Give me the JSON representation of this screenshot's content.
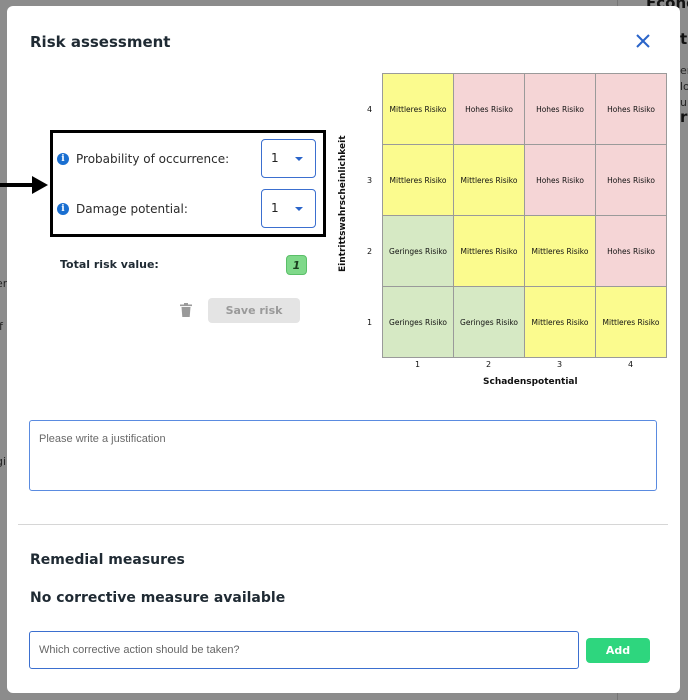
{
  "background": {
    "heading_fragment": "Econo",
    "right_fragments": [
      "tr",
      "en",
      "lo",
      "ul",
      "rs"
    ],
    "left_fragments": [
      "er",
      "if",
      "gi"
    ]
  },
  "modal": {
    "title": "Risk assessment",
    "close_icon": "close-icon"
  },
  "form": {
    "probability": {
      "label": "Probability of occurrence:",
      "value": "1"
    },
    "damage": {
      "label": "Damage potential:",
      "value": "1"
    },
    "total_label": "Total risk value:",
    "total_value": "1",
    "save_label": "Save risk",
    "delete_icon": "trash-icon"
  },
  "matrix": {
    "y_label": "Eintrittswahrscheinlichkeit",
    "x_label": "Schadenspotential",
    "y_ticks": [
      "4",
      "3",
      "2",
      "1"
    ],
    "x_ticks": [
      "1",
      "2",
      "3",
      "4"
    ],
    "rows": [
      [
        "Mittleres Risiko",
        "Hohes Risiko",
        "Hohes Risiko",
        "Hohes Risiko"
      ],
      [
        "Mittleres Risiko",
        "Mittleres Risiko",
        "Hohes Risiko",
        "Hohes Risiko"
      ],
      [
        "Geringes Risiko",
        "Mittleres Risiko",
        "Mittleres Risiko",
        "Hohes Risiko"
      ],
      [
        "Geringes Risiko",
        "Geringes Risiko",
        "Mittleres Risiko",
        "Mittleres Risiko"
      ]
    ],
    "colors": {
      "Geringes Risiko": "#d6e9c4",
      "Mittleres Risiko": "#fbfb8e",
      "Hohes Risiko": "#f5d5d6"
    }
  },
  "justification": {
    "placeholder": "Please write a justification"
  },
  "remedial": {
    "title": "Remedial measures",
    "empty_text": "No corrective measure available",
    "input_placeholder": "Which corrective action should be taken?",
    "add_label": "Add"
  }
}
